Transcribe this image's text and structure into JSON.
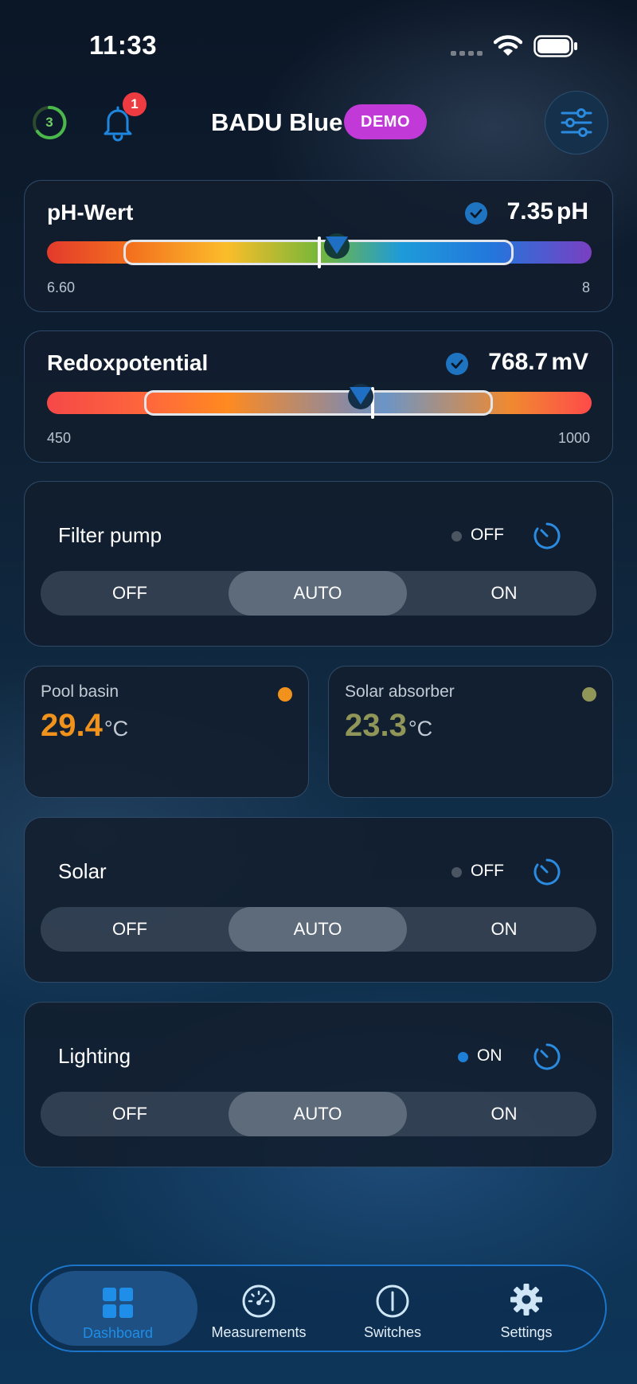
{
  "status_bar": {
    "time": "11:33"
  },
  "header": {
    "timer_count": "3",
    "notification_count": "1",
    "title": "BADU Blue",
    "badge": "DEMO"
  },
  "measurements": [
    {
      "title": "pH-Wert",
      "value": "7.35",
      "unit": "pH",
      "min": "6.60",
      "max": "8"
    },
    {
      "title": "Redoxpotential",
      "value": "768.7",
      "unit": "mV",
      "min": "450",
      "max": "1000"
    }
  ],
  "filter_pump": {
    "title": "Filter pump",
    "state": "OFF",
    "options": [
      "OFF",
      "AUTO",
      "ON"
    ],
    "selected": "AUTO"
  },
  "temperatures": [
    {
      "label": "Pool basin",
      "value": "29.4",
      "unit": "°C",
      "color": "#f0921c"
    },
    {
      "label": "Solar absorber",
      "value": "23.3",
      "unit": "°C",
      "color": "#8f9658"
    }
  ],
  "solar": {
    "title": "Solar",
    "state": "OFF",
    "options": [
      "OFF",
      "AUTO",
      "ON"
    ],
    "selected": "AUTO"
  },
  "lighting": {
    "title": "Lighting",
    "state": "ON",
    "options": [
      "OFF",
      "AUTO",
      "ON"
    ],
    "selected": "AUTO"
  },
  "nav": {
    "items": [
      {
        "label": "Dashboard",
        "icon": "dashboard-grid-icon",
        "active": true
      },
      {
        "label": "Measurements",
        "icon": "gauge-icon"
      },
      {
        "label": "Switches",
        "icon": "power-icon"
      },
      {
        "label": "Settings",
        "icon": "gear-icon"
      }
    ]
  },
  "colors": {
    "accent": "#1f74c2",
    "demo_badge": "#c13ad8",
    "alert": "#ee3b42",
    "state_on": "#1e7fd6",
    "state_off": "#4a5561"
  }
}
